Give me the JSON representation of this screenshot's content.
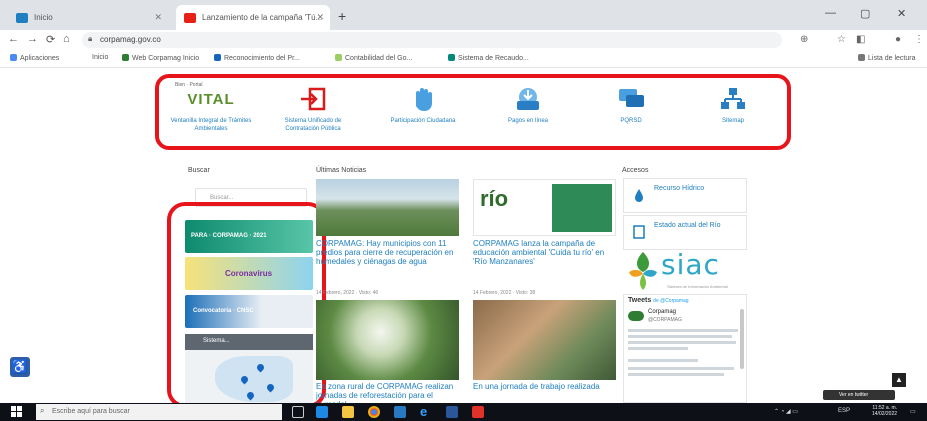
{
  "browser": {
    "tabs": [
      {
        "title": "Inicio",
        "active": false
      },
      {
        "title": "Lanzamiento de la campaña 'Tú...",
        "active": true
      }
    ],
    "new_tab_symbol": "+",
    "close_symbol": "✕",
    "url": "corpamag.gov.co",
    "bookmarks": [
      "Aplicaciones",
      "Inicio",
      "Web Corpamag Inicio",
      "Reconocimiento del Pr...",
      "Contabilidad del Go...",
      "Sistema de Recaudo..."
    ],
    "reading_list": "Lista de lectura"
  },
  "menu": {
    "vital_small": "Bien · Portal",
    "vital_word": "VITAL",
    "items": [
      {
        "label": "Ventanilla Integral de Trámites Ambientales",
        "icon": "vital-logo"
      },
      {
        "label": "Sistema Unificado de Contratación Pública",
        "icon": "login-arrow-icon"
      },
      {
        "label": "Participación Ciudadana",
        "icon": "hand-icon"
      },
      {
        "label": "Pagos en línea",
        "icon": "tray-download-icon"
      },
      {
        "label": "PQRSD",
        "icon": "chat-bubbles-icon"
      },
      {
        "label": "Sitemap",
        "icon": "sitemap-icon"
      }
    ]
  },
  "sidebar": {
    "title": "Buscar",
    "search_placeholder": "Buscar...",
    "banners": [
      {
        "text": "PARA · CORPAMAG · 2021"
      },
      {
        "text": "Coronavirus"
      },
      {
        "text": "Convocatoria · CNSC"
      }
    ],
    "map_title": "Sistema..."
  },
  "news": {
    "title": "Últimas Noticias",
    "items": [
      {
        "title": "CORPAMAG: Hay municipios con 11 predios para cierre de recuperación en humedales y ciénagas de agua",
        "meta": "14 Febrero, 2022 · Visto: 46"
      },
      {
        "title": "CORPAMAG lanza la campaña de educación ambiental 'Cuida tu río' en 'Río Manzanares'",
        "meta": "14 Febrero, 2022 · Visto: 38"
      },
      {
        "title": "En zona rural de CORPAMAG realizan jornadas de reforestación para el humedal",
        "meta": ""
      },
      {
        "title": "En una jornada de trabajo realizada",
        "meta": ""
      }
    ]
  },
  "accesos": {
    "title": "Accesos",
    "items": [
      {
        "label": "Recurso Hídrico"
      },
      {
        "label": "Estado actual del Río"
      }
    ],
    "siac_word": "siac",
    "siac_sub": "Sistema de Información Ambiental",
    "tweets_title": "Tweets",
    "tweets_by": "de @Corpamag",
    "tweet_account": "Corpamag",
    "tweet_handle": "@CORPAMAG"
  },
  "page_buttons": {
    "accessibility": "♿",
    "scroll_top": "▲",
    "tweet_button": "Ver en twitter"
  },
  "taskbar": {
    "search_placeholder": "Escribe aquí para buscar",
    "lang": "ESP",
    "time": "11:52 a. m.",
    "date": "14/02/2022"
  },
  "colors": {
    "highlight_red": "#e8141b",
    "link_blue": "#1f7fc0",
    "siac_teal": "#2fa6c8",
    "vital_green": "#5a8f2b"
  }
}
